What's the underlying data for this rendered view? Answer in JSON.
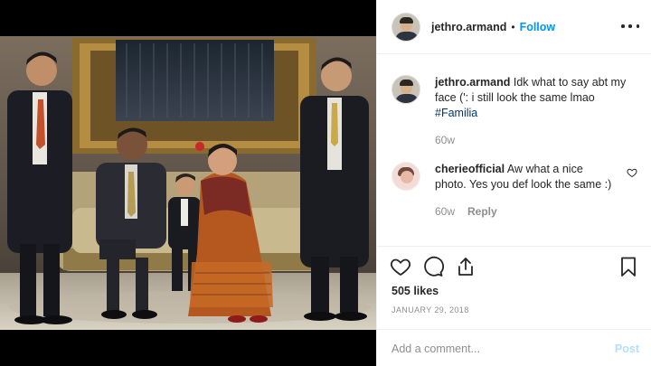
{
  "post": {
    "photo_alt": "Family portrait in front of an ornate gold-framed mirror"
  },
  "header": {
    "username": "jethro.armand",
    "separator": "•",
    "follow_label": "Follow"
  },
  "caption": {
    "username": "jethro.armand",
    "text": "Idk what to say abt my face (': i still look the same lmao",
    "hashtag": "#Familia",
    "age": "60w"
  },
  "comments": [
    {
      "username": "cherieofficial",
      "text": "Aw what a nice photo. Yes you def look the same :)",
      "age": "60w",
      "reply_label": "Reply"
    }
  ],
  "actions": {
    "icons": [
      "heart-icon",
      "comment-icon",
      "share-icon",
      "bookmark-icon"
    ],
    "likes": "505 likes",
    "date": "JANUARY 29, 2018"
  },
  "composer": {
    "placeholder": "Add a comment...",
    "post_label": "Post"
  },
  "colors": {
    "link_blue": "#0095f6",
    "post_disabled": "#b2dffc",
    "muted_text": "#8e8e8e"
  }
}
